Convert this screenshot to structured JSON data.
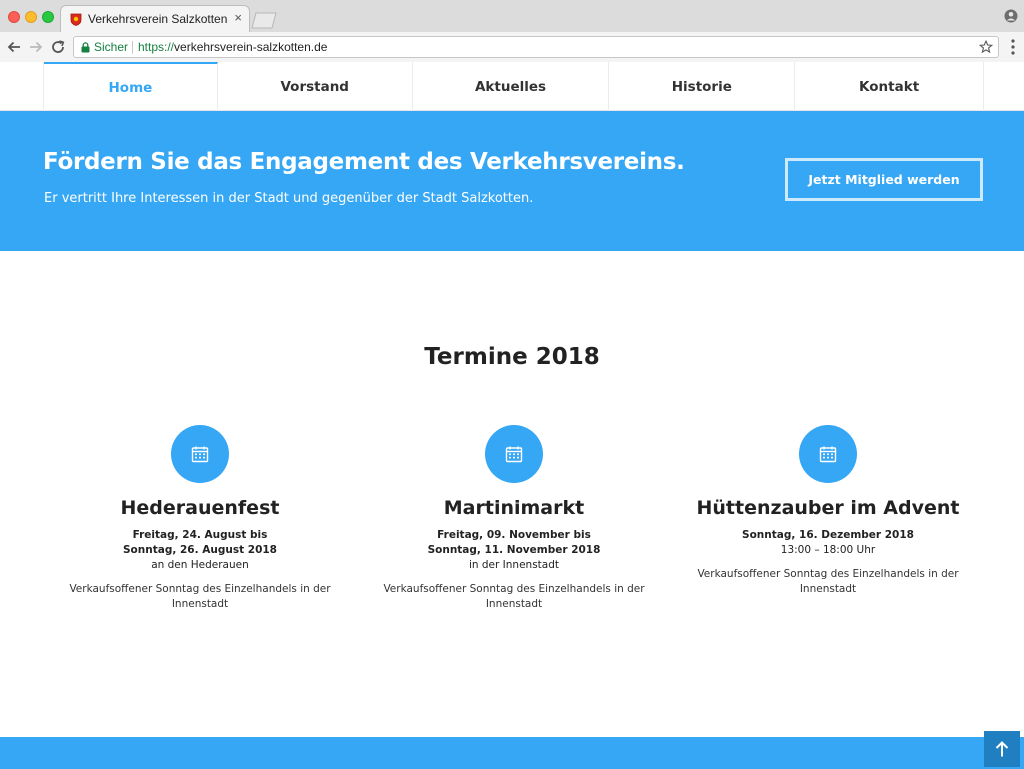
{
  "browser": {
    "tab_title": "Verkehrsverein Salzkotten e.V.",
    "tab_close": "×",
    "secure_label": "Sicher",
    "url_scheme": "https://",
    "url_host": "verkehrsverein-salzkotten.de"
  },
  "nav": {
    "items": [
      {
        "label": "Home",
        "active": true
      },
      {
        "label": "Vorstand"
      },
      {
        "label": "Aktuelles"
      },
      {
        "label": "Historie"
      },
      {
        "label": "Kontakt"
      }
    ]
  },
  "hero": {
    "title": "Fördern Sie das Engagement des Verkehrsvereins.",
    "subtitle": "Er vertritt Ihre Interessen in der Stadt und gegenüber der Stadt Salzkotten.",
    "cta_label": "Jetzt Mitglied werden"
  },
  "events": {
    "heading": "Termine 2018",
    "items": [
      {
        "icon": "calendar-icon",
        "title": "Hederauenfest",
        "date_line1": "Freitag, 24. August bis",
        "date_line2": "Sonntag, 26. August 2018",
        "place": "an den Hederauen",
        "description": "Verkaufsoffener Sonntag des Einzelhandels in der Innenstadt"
      },
      {
        "icon": "calendar-icon",
        "title": "Martinimarkt",
        "date_line1": "Freitag, 09. November bis",
        "date_line2": "Sonntag, 11. November 2018",
        "place": "in der Innenstadt",
        "description": "Verkaufsoffener Sonntag des Einzelhandels in der Innenstadt"
      },
      {
        "icon": "calendar-icon",
        "title": "Hüttenzauber im Advent",
        "date_line1": "Sonntag, 16. Dezember 2018",
        "date_line2": "",
        "place": "13:00 – 18:00 Uhr",
        "description": "Verkaufsoffener Sonntag des Einzelhandels in der Innenstadt"
      }
    ]
  },
  "colors": {
    "brand_blue": "#35a7f5",
    "back_to_top": "#1f7fc0"
  }
}
